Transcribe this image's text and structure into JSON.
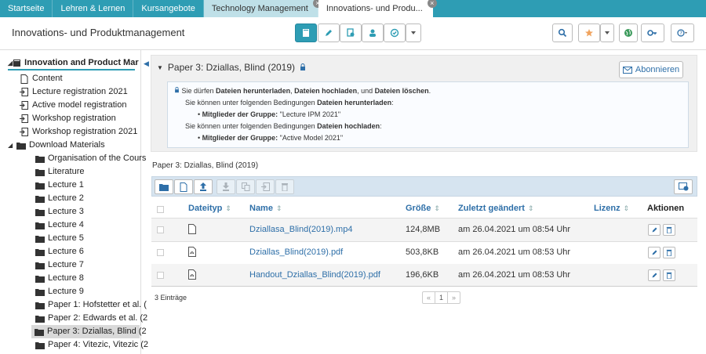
{
  "topnav": {
    "tabs": [
      {
        "label": "Startseite"
      },
      {
        "label": "Lehren & Lernen"
      },
      {
        "label": "Kursangebote"
      },
      {
        "label": "Technology Management"
      },
      {
        "label": "Innovations- und Produ..."
      }
    ]
  },
  "header": {
    "title": "Innovations- und Produktmanagement"
  },
  "sidebar": {
    "root": "Innovation and Product Mar",
    "items": [
      {
        "label": "Content",
        "icon": "document-icon"
      },
      {
        "label": "Lecture registration 2021",
        "icon": "signin-icon"
      },
      {
        "label": "Active model registration",
        "icon": "signin-icon"
      },
      {
        "label": "Workshop registration",
        "icon": "signin-icon"
      },
      {
        "label": "Workshop registration 2021",
        "icon": "signin-icon"
      },
      {
        "label": "Download Materials",
        "icon": "folder-icon"
      }
    ],
    "folders": [
      {
        "label": "Organisation of the Cours"
      },
      {
        "label": "Literature"
      },
      {
        "label": "Lecture 1"
      },
      {
        "label": "Lecture 2"
      },
      {
        "label": "Lecture 3"
      },
      {
        "label": "Lecture 4"
      },
      {
        "label": "Lecture 5"
      },
      {
        "label": "Lecture 6"
      },
      {
        "label": "Lecture 7"
      },
      {
        "label": "Lecture 8"
      },
      {
        "label": "Lecture 9"
      },
      {
        "label": "Paper 1: Hofstetter et al. ("
      },
      {
        "label": "Paper 2: Edwards et al. (2"
      },
      {
        "label": "Paper 3: Dziallas, Blind (2"
      },
      {
        "label": "Paper 4: Vitezic, Vitezic (2"
      }
    ]
  },
  "main": {
    "title": "Paper 3: Dziallas, Blind (2019)",
    "subscribe_label": "Abonnieren",
    "info": {
      "line1_pre": "Sie dürfen ",
      "line1_b1": "Dateien herunterladen",
      "line1_sep1": ", ",
      "line1_b2": "Dateien hochladen",
      "line1_sep2": ", und ",
      "line1_b3": "Dateien löschen",
      "line1_end": ".",
      "line2_pre": "Sie können unter folgenden Bedingungen ",
      "line2_b": "Dateien herunterladen",
      "line2_end": ":",
      "line3_b": "Mitglieder der Gruppe:",
      "line3_val": " \"Lecture IPM 2021\"",
      "line4_pre": "Sie können unter folgenden Bedingungen ",
      "line4_b": "Dateien hochladen",
      "line4_end": ":",
      "line5_b": "Mitglieder der Gruppe:",
      "line5_val": " \"Active Model 2021\""
    },
    "subheading": "Paper 3: Dziallas, Blind (2019)",
    "table": {
      "headers": {
        "type": "Dateityp",
        "name": "Name",
        "size": "Größe",
        "modified": "Zuletzt geändert",
        "license": "Lizenz",
        "actions": "Aktionen"
      },
      "rows": [
        {
          "icon": "file-icon",
          "name": "Dziallasa_Blind(2019).mp4",
          "size": "124,8MB",
          "modified": "am 26.04.2021 um 08:54 Uhr"
        },
        {
          "icon": "pdf-icon",
          "name": "Dziallas_Blind(2019).pdf",
          "size": "503,8KB",
          "modified": "am 26.04.2021 um 08:53 Uhr"
        },
        {
          "icon": "pdf-icon",
          "name": "Handout_Dziallas_Blind(2019).pdf",
          "size": "196,6KB",
          "modified": "am 26.04.2021 um 08:53 Uhr"
        }
      ]
    },
    "entries_label": "3 Einträge",
    "pager": {
      "prev": "«",
      "page": "1",
      "next": "»"
    }
  }
}
